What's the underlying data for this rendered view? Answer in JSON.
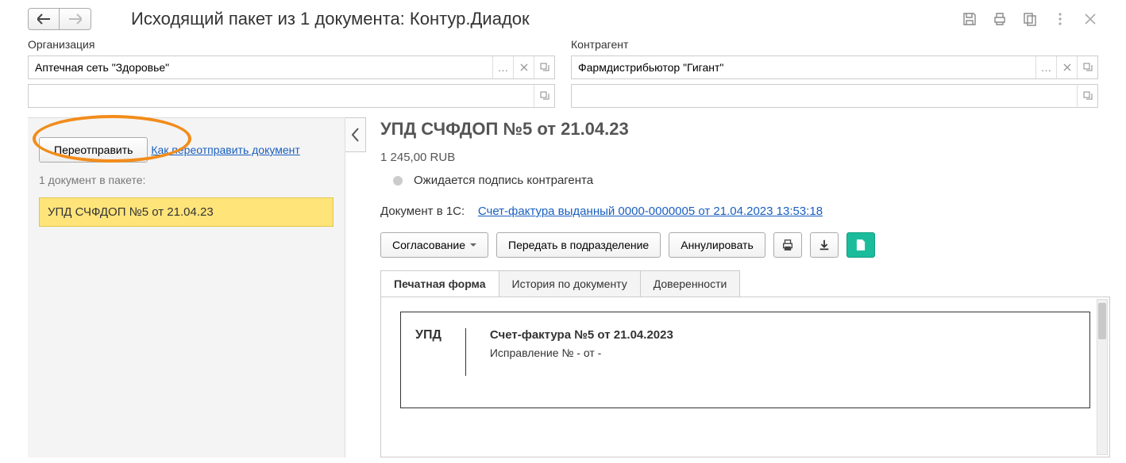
{
  "header": {
    "title": "Исходящий пакет из 1 документа: Контур.Диадок"
  },
  "fields": {
    "org_label": "Организация",
    "org_value": "Аптечная сеть \"Здоровье\"",
    "party_label": "Контрагент",
    "party_value": "Фармдистрибьютор \"Гигант\""
  },
  "sidebar": {
    "resend_label": "Переотправить",
    "how_link": "Как переотправить документ",
    "count_text": "1 документ в пакете:",
    "doc_item": "УПД СЧФДОП №5 от 21.04.23"
  },
  "detail": {
    "title": "УПД СЧФДОП №5 от 21.04.23",
    "amount": "1 245,00  RUB",
    "status_text": "Ожидается подпись контрагента",
    "docline_label": "Документ в 1С:",
    "docline_link": "Счет-фактура выданный 0000-0000005 от 21.04.2023 13:53:18",
    "buttons": {
      "approve": "Согласование",
      "transfer": "Передать в подразделение",
      "cancel": "Аннулировать"
    },
    "tabs": {
      "print": "Печатная форма",
      "history": "История по документу",
      "poa": "Доверенности"
    },
    "preview": {
      "upd": "УПД",
      "invoice": "Счет-фактура №5 от 21.04.2023",
      "correction": "Исправление № - от -"
    }
  }
}
